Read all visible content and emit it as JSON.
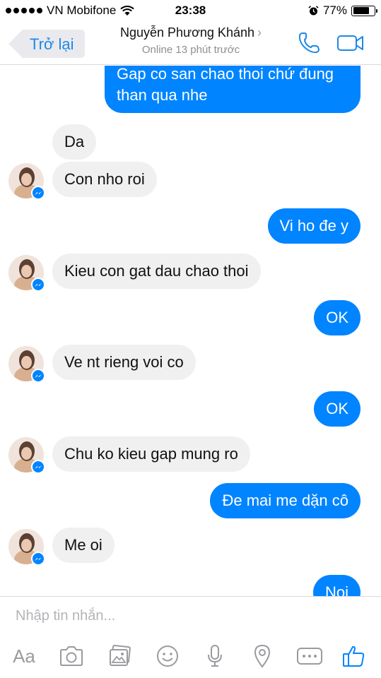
{
  "status_bar": {
    "carrier": "VN Mobifone",
    "time": "23:38",
    "battery_percent": "77%",
    "battery_level": 0.77
  },
  "header": {
    "back_label": "Trở lại",
    "contact_name": "Nguyễn Phương Khánh",
    "contact_status": "Online 13 phút trước"
  },
  "messages": [
    {
      "direction": "outgoing",
      "text": "Gap co san chao thoi chứ đung than qua nhe"
    },
    {
      "direction": "incoming",
      "text": "Da"
    },
    {
      "direction": "incoming",
      "text": "Con nho roi"
    },
    {
      "direction": "outgoing",
      "text": "Vi ho đe y"
    },
    {
      "direction": "incoming",
      "text": "Kieu con gat dau chao thoi"
    },
    {
      "direction": "outgoing",
      "text": "OK"
    },
    {
      "direction": "incoming",
      "text": "Ve nt rieng voi co"
    },
    {
      "direction": "outgoing",
      "text": "OK"
    },
    {
      "direction": "incoming",
      "text": "Chu ko kieu gap mung ro"
    },
    {
      "direction": "outgoing",
      "text": "Đe mai me dặn cô"
    },
    {
      "direction": "incoming",
      "text": "Me oi"
    },
    {
      "direction": "outgoing",
      "text": "Noi"
    }
  ],
  "composer": {
    "placeholder": "Nhập tin nhắn...",
    "text_button_label": "Aa"
  },
  "toolbar_icons": [
    "text-format-icon",
    "camera-icon",
    "photo-gallery-icon",
    "emoji-icon",
    "microphone-icon",
    "location-icon",
    "more-icon",
    "like-icon"
  ],
  "colors": {
    "accent": "#0084ff",
    "back_text": "#1e88e5",
    "incoming_bubble": "#f1f0f0",
    "icon_gray": "#9a9aa0"
  }
}
